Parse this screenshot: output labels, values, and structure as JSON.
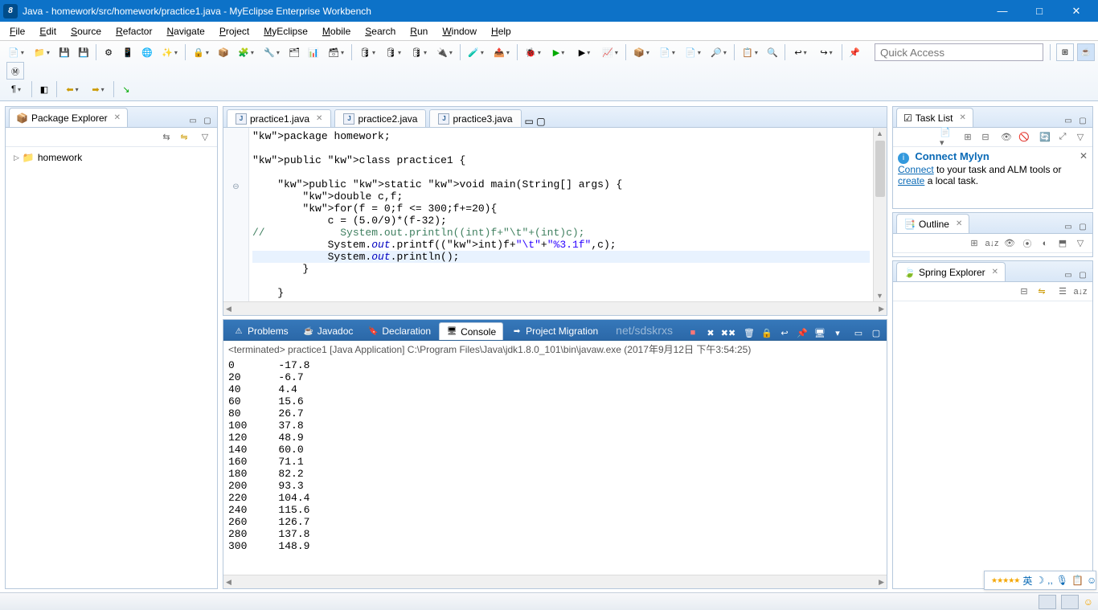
{
  "title": "Java - homework/src/homework/practice1.java - MyEclipse Enterprise Workbench",
  "menus": [
    "File",
    "Edit",
    "Source",
    "Refactor",
    "Navigate",
    "Project",
    "MyEclipse",
    "Mobile",
    "Search",
    "Run",
    "Window",
    "Help"
  ],
  "quick_access_placeholder": "Quick Access",
  "package_explorer": {
    "title": "Package Explorer",
    "project": "homework"
  },
  "editor": {
    "tabs": [
      "practice1.java",
      "practice2.java",
      "practice3.java"
    ],
    "active_tab": 0,
    "code_lines": [
      {
        "t": "package",
        "txt": "package homework;"
      },
      {
        "t": "blank",
        "txt": ""
      },
      {
        "t": "decl",
        "txt": "public class practice1 {"
      },
      {
        "t": "blank",
        "txt": "    "
      },
      {
        "t": "decl",
        "txt": "    public static void main(String[] args) {"
      },
      {
        "t": "decl",
        "txt": "        double c,f;"
      },
      {
        "t": "for",
        "txt": "        for(f = 0;f <= 300;f+=20){"
      },
      {
        "t": "stmt",
        "txt": "            c = (5.0/9)*(f-32);"
      },
      {
        "t": "cmt",
        "txt": "//            System.out.println((int)f+\"\\t\"+(int)c);"
      },
      {
        "t": "printf",
        "txt": "            System.out.printf((int)f+\"\\t\"+\"%3.1f\",c);"
      },
      {
        "t": "println",
        "txt": "            System.out.println();"
      },
      {
        "t": "stmt",
        "txt": "        }"
      },
      {
        "t": "blank",
        "txt": "        "
      },
      {
        "t": "stmt",
        "txt": "    }"
      }
    ]
  },
  "bottom_tabs": [
    "Problems",
    "Javadoc",
    "Declaration",
    "Console",
    "Project Migration"
  ],
  "bottom_active": 3,
  "console": {
    "header": "<terminated> practice1 [Java Application] C:\\Program Files\\Java\\jdk1.8.0_101\\bin\\javaw.exe (2017年9月12日 下午3:54:25)",
    "rows": [
      [
        "0",
        "-17.8"
      ],
      [
        "20",
        "-6.7"
      ],
      [
        "40",
        "4.4"
      ],
      [
        "60",
        "15.6"
      ],
      [
        "80",
        "26.7"
      ],
      [
        "100",
        "37.8"
      ],
      [
        "120",
        "48.9"
      ],
      [
        "140",
        "60.0"
      ],
      [
        "160",
        "71.1"
      ],
      [
        "180",
        "82.2"
      ],
      [
        "200",
        "93.3"
      ],
      [
        "220",
        "104.4"
      ],
      [
        "240",
        "115.6"
      ],
      [
        "260",
        "126.7"
      ],
      [
        "280",
        "137.8"
      ],
      [
        "300",
        "148.9"
      ]
    ]
  },
  "task_list": {
    "title": "Task List",
    "mylyn_title": "Connect Mylyn",
    "mylyn_text1": " to your task and ALM tools or ",
    "mylyn_link1": "Connect",
    "mylyn_link2": "create",
    "mylyn_text2": " a local task."
  },
  "outline": {
    "title": "Outline"
  },
  "spring": {
    "title": "Spring Explorer"
  },
  "watermark": "net/sdskrxs",
  "ime": {
    "lang": "英",
    "stars": "★★★★★"
  }
}
